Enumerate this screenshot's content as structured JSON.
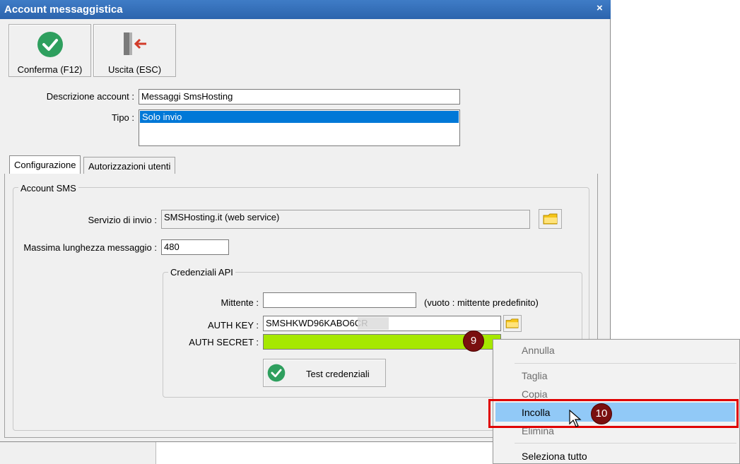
{
  "window": {
    "title": "Account messaggistica",
    "close_glyph": "×"
  },
  "toolbar": {
    "confirm_label": "Conferma (F12)",
    "exit_label": "Uscita (ESC)",
    "confirm_icon": "check-circle-icon",
    "exit_icon": "exit-door-icon"
  },
  "form": {
    "description_label": "Descrizione account :",
    "description_value": "Messaggi SmsHosting",
    "type_label": "Tipo :",
    "type_options": [
      "Solo invio"
    ]
  },
  "tabs": [
    {
      "label": "Configurazione",
      "active": true
    },
    {
      "label": "Autorizzazioni utenti",
      "active": false
    }
  ],
  "sms_account": {
    "group_title": "Account SMS",
    "service_label": "Servizio di invio :",
    "service_value": "SMSHosting.it (web service)",
    "max_length_label": "Massima lunghezza messaggio :",
    "max_length_value": "480"
  },
  "credentials": {
    "group_title": "Credenziali API",
    "sender_label": "Mittente :",
    "sender_value": "",
    "sender_hint": "(vuoto : mittente predefinito)",
    "auth_key_label": "AUTH KEY :",
    "auth_key_value": "SMSHKWD96KABO6CR",
    "auth_secret_label": "AUTH SECRET :",
    "auth_secret_value": "",
    "test_label": "Test credenziali"
  },
  "context_menu": {
    "items": [
      {
        "label": "Annulla",
        "enabled": false
      },
      {
        "label": "Taglia",
        "enabled": false
      },
      {
        "label": "Copia",
        "enabled": false
      },
      {
        "label": "Incolla",
        "enabled": true,
        "highlighted": true
      },
      {
        "label": "Elimina",
        "enabled": false
      },
      {
        "label": "Seleziona tutto",
        "enabled": true
      }
    ]
  },
  "annotations": {
    "step_a": "9",
    "step_b": "10"
  },
  "colors": {
    "accent": "#3f7cc6",
    "selection": "#0078d7",
    "highlight_field": "#a6e800",
    "menu_highlight": "#91c9f7",
    "callout": "#e00000",
    "badge": "#7a0f0f"
  }
}
